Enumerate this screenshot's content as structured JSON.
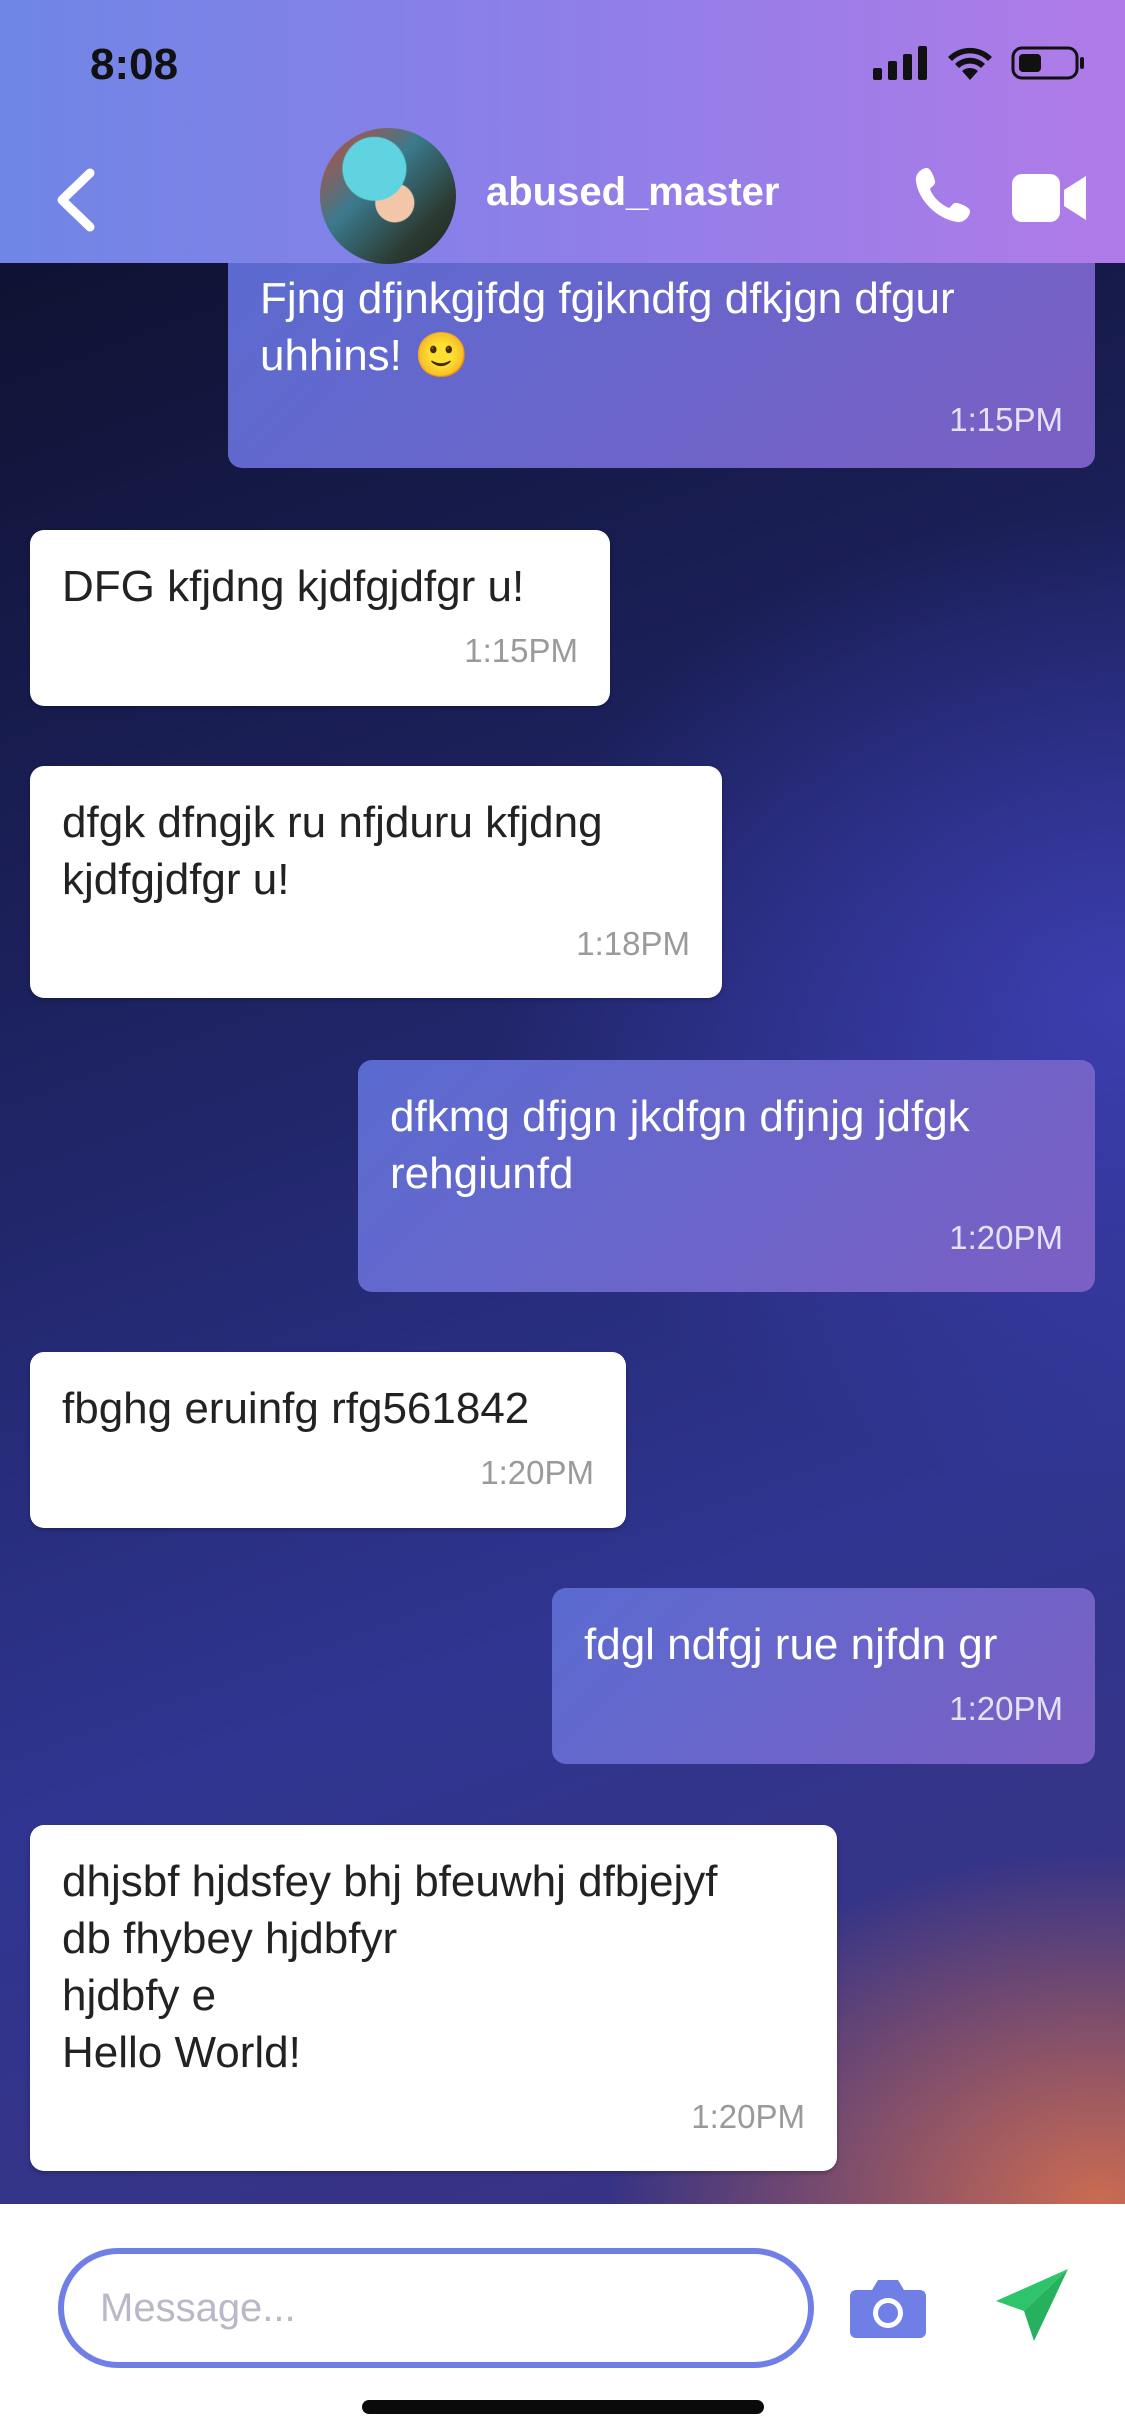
{
  "status_bar": {
    "time": "8:08"
  },
  "header": {
    "username": "abused_master",
    "icons": [
      "back-icon",
      "avatar",
      "phone-icon",
      "video-camera-icon"
    ]
  },
  "messages": [
    {
      "direction": "outgoing",
      "text": "Fjng dfjnkgjfdg fgjkndfg dfkjgn dfgur uhhins! 🙂",
      "time": "1:15PM"
    },
    {
      "direction": "incoming",
      "text": "DFG kfjdng kjdfgjdfgr u!",
      "time": "1:15PM"
    },
    {
      "direction": "incoming",
      "text": "dfgk dfngjk ru nfjduru kfjdng kjdfgjdfgr u!",
      "time": "1:18PM"
    },
    {
      "direction": "outgoing",
      "text": "dfkmg dfjgn jkdfgn dfjnjg jdfgk rehgiunfd",
      "time": "1:20PM"
    },
    {
      "direction": "incoming",
      "text": "fbghg eruinfg rfg561842",
      "time": "1:20PM"
    },
    {
      "direction": "outgoing",
      "text": "fdgl ndfgj rue njfdn gr",
      "time": "1:20PM"
    },
    {
      "direction": "incoming",
      "text": "dhjsbf hjdsfey bhj bfeuwhj dfbjejyf\ndb fhybey hjdbfyr\nhjdbfy e\nHello World!",
      "time": "1:20PM"
    }
  ],
  "composer": {
    "placeholder": "Message...",
    "value": "",
    "icons": [
      "camera-icon",
      "send-icon"
    ]
  },
  "colors": {
    "header_gradient_start": "#6f86e6",
    "header_gradient_end": "#b07be8",
    "outgoing_bubble": "#6a64cc",
    "incoming_bubble": "#ffffff",
    "input_border": "#6f7fe6",
    "camera_icon": "#6f7fe6",
    "send_icon": "#2ec46a"
  }
}
